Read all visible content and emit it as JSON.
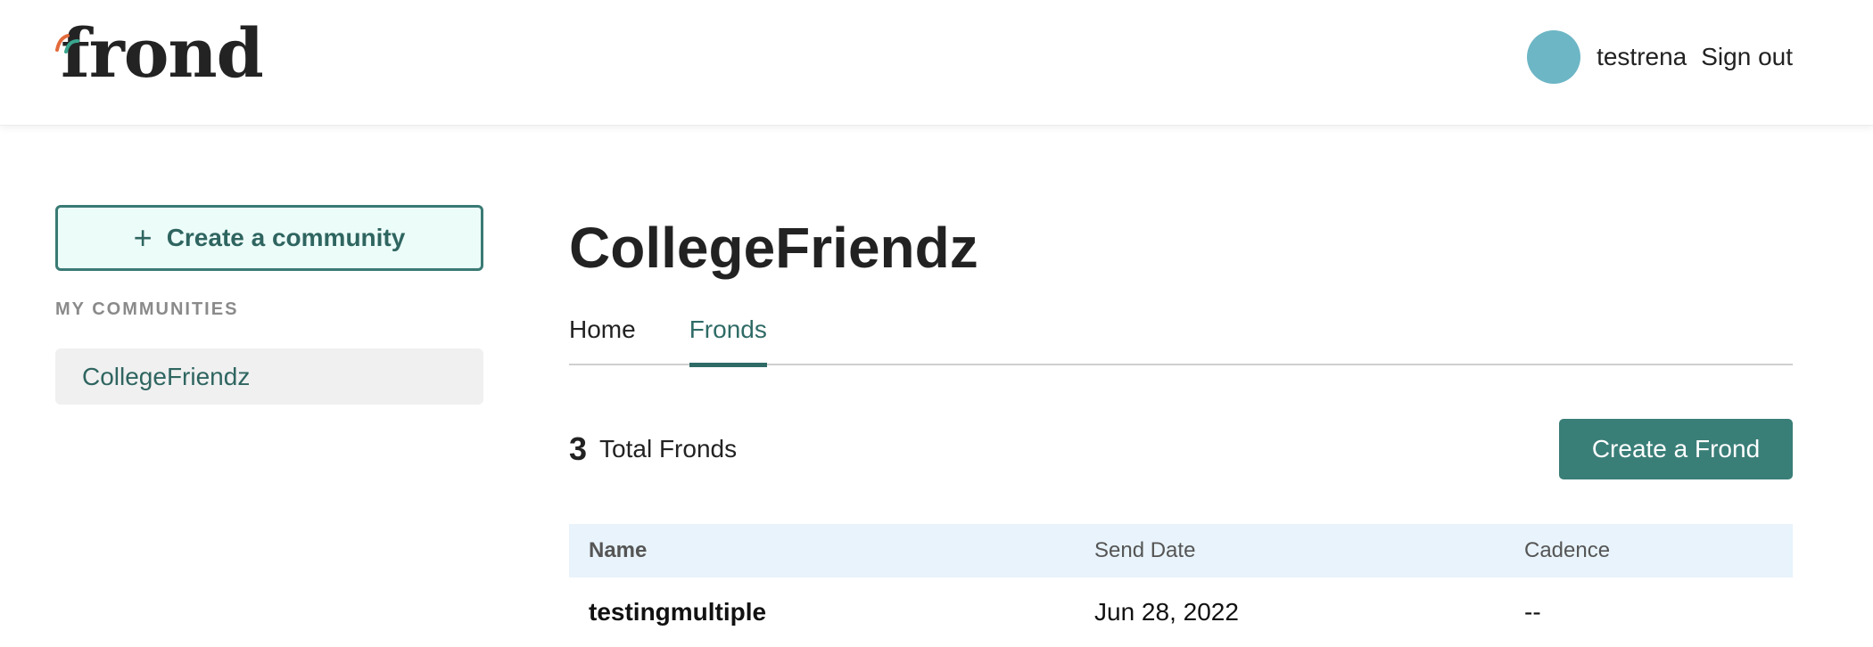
{
  "header": {
    "logo_text": "frond",
    "username": "testrena",
    "signout_label": "Sign out"
  },
  "sidebar": {
    "create_label": "Create a community",
    "section_label": "MY COMMUNITIES",
    "communities": [
      {
        "label": "CollegeFriendz"
      }
    ]
  },
  "main": {
    "title": "CollegeFriendz",
    "tabs": [
      {
        "label": "Home",
        "active": false
      },
      {
        "label": "Fronds",
        "active": true
      }
    ],
    "total_count": "3",
    "total_label": "Total Fronds",
    "create_frond_label": "Create a Frond",
    "table": {
      "columns": [
        "Name",
        "Send Date",
        "Cadence"
      ],
      "rows": [
        {
          "name": "testingmultiple",
          "send_date": "Jun 28, 2022",
          "cadence": "--"
        }
      ]
    }
  },
  "colors": {
    "accent": "#3a7e78",
    "avatar": "#6db6c5",
    "table_header_bg": "#e8f3fb",
    "create_community_bg": "#ecfdf9"
  }
}
